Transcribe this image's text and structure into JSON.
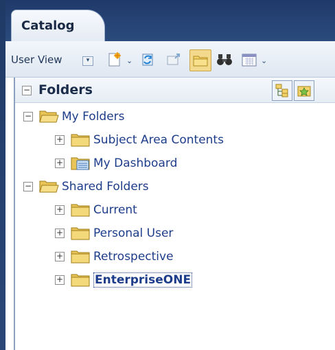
{
  "catalog_tab": {
    "label": "Catalog"
  },
  "toolbar": {
    "view_label": "User View",
    "buttons": [
      {
        "name": "new-icon"
      },
      {
        "name": "refresh-icon"
      },
      {
        "name": "move-icon"
      },
      {
        "name": "folders-view-icon",
        "selected": true
      },
      {
        "name": "search-binoculars-icon"
      },
      {
        "name": "calendar-icon"
      }
    ]
  },
  "folders_panel": {
    "title": "Folders",
    "tree": [
      {
        "label": "My Folders",
        "level": 0,
        "expanded": true,
        "icon": "open-folder-icon"
      },
      {
        "label": "Subject Area Contents",
        "level": 1,
        "expanded": false,
        "icon": "folder-icon"
      },
      {
        "label": "My Dashboard",
        "level": 1,
        "expanded": false,
        "icon": "dashboard-folder-icon"
      },
      {
        "label": "Shared Folders",
        "level": 0,
        "expanded": true,
        "icon": "open-folder-icon"
      },
      {
        "label": "Current",
        "level": 1,
        "expanded": false,
        "icon": "folder-icon"
      },
      {
        "label": "Personal User",
        "level": 1,
        "expanded": false,
        "icon": "folder-icon"
      },
      {
        "label": "Retrospective",
        "level": 1,
        "expanded": false,
        "icon": "folder-icon"
      },
      {
        "label": "EnterpriseONE",
        "level": 1,
        "expanded": false,
        "icon": "folder-icon",
        "selected": true
      }
    ]
  },
  "colors": {
    "header": "#203a66",
    "link": "#1d3c8a",
    "selection": "#f3d98b"
  }
}
